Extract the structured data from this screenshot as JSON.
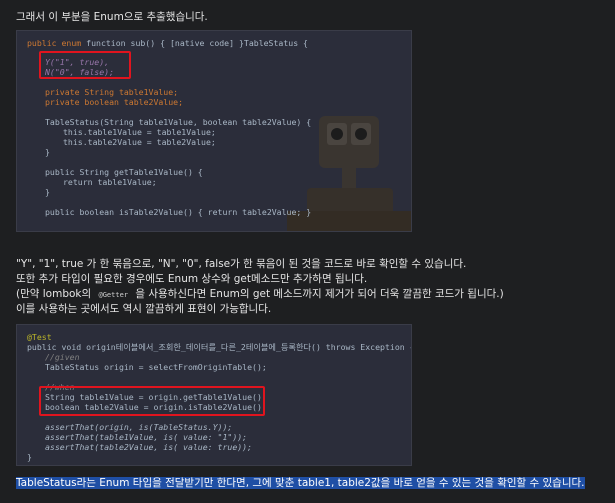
{
  "intro": "그래서 이 부분을 Enum으로 추출했습니다.",
  "code1": {
    "l1": "public enum TableStatus {",
    "l2": "Y(\"1\", true),",
    "l3": "N(\"0\", false);",
    "l4": "private String table1Value;",
    "l5": "private boolean table2Value;",
    "l6": "TableStatus(String table1Value, boolean table2Value) {",
    "l7": "this.table1Value = table1Value;",
    "l8": "this.table2Value = table2Value;",
    "l9": "}",
    "l10": "public String getTable1Value() {",
    "l11": "return table1Value;",
    "l12": "}",
    "l13": "public boolean isTable2Value() { return table2Value; }"
  },
  "para1": "\"Y\", \"1\", true 가 한 묶음으로, \"N\", \"0\", false가 한 묶음이 된 것을 코드로 바로 확인할 수 있습니다.",
  "para2": "또한 추가 타입이 필요한 경우에도 Enum 상수와 get메소드만 추가하면 됩니다.",
  "para3_a": "(만약 lombok의",
  "para3_getter": "@Getter",
  "para3_b": "을 사용하신다면 Enum의 get 메소드까지 제거가 되어 더욱 깔끔한 코드가 됩니다.)",
  "para4": "이를 사용하는 곳에서도 역시 깔끔하게 표현이 가능합니다.",
  "code2": {
    "l1": "@Test",
    "l2": "public void origin테이블에서_조회한_데이터를_다른_2테이블에_등록한다() throws Exception {",
    "l3": "//given",
    "l4": "TableStatus origin = selectFromOriginTable();",
    "l5": "//when",
    "l6": "String table1Value = origin.getTable1Value();",
    "l7": "boolean table2Value = origin.isTable2Value();",
    "l8": "assertThat(origin, is(TableStatus.Y));",
    "l9": "assertThat(table1Value, is( value: \"1\"));",
    "l10": "assertThat(table2Value, is( value: true));",
    "l11": "}"
  },
  "conclusion": "TableStatus라는 Enum 타입을 전달받기만 한다면, 그에 맞춘 table1, table2값을 바로 얻을 수 있는 것을 확인할 수 있습니다."
}
